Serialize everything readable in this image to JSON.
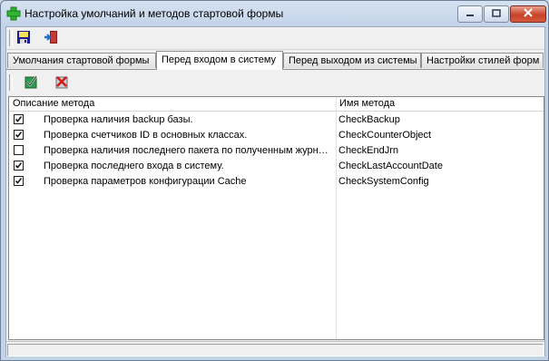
{
  "window": {
    "title": "Настройка умолчаний и методов стартовой формы"
  },
  "tabs": [
    {
      "label": "Умолчания стартовой формы",
      "active": false
    },
    {
      "label": "Перед входом в систему",
      "active": true
    },
    {
      "label": "Перед выходом из системы",
      "active": false
    },
    {
      "label": "Настройки стилей форм",
      "active": false
    }
  ],
  "grid": {
    "columns": [
      "Описание метода",
      "Имя метода"
    ],
    "rows": [
      {
        "checked": true,
        "description": "Проверка наличия backup базы.",
        "method": "CheckBackup"
      },
      {
        "checked": true,
        "description": "Проверка счетчиков ID в основных классах.",
        "method": "CheckCounterObject"
      },
      {
        "checked": false,
        "description": "Проверка наличия последнего пакета по полученным журналам",
        "method": "CheckEndJrn"
      },
      {
        "checked": true,
        "description": "Проверка последнего входа в систему.",
        "method": "CheckLastAccountDate"
      },
      {
        "checked": true,
        "description": "Проверка параметров конфигурации Cache",
        "method": "CheckSystemConfig"
      }
    ]
  },
  "icons": {
    "app": "green-plus-icon",
    "save": "save-icon",
    "exit": "exit-door-icon",
    "check_all": "check-all-icon",
    "uncheck_all": "uncheck-all-icon"
  }
}
